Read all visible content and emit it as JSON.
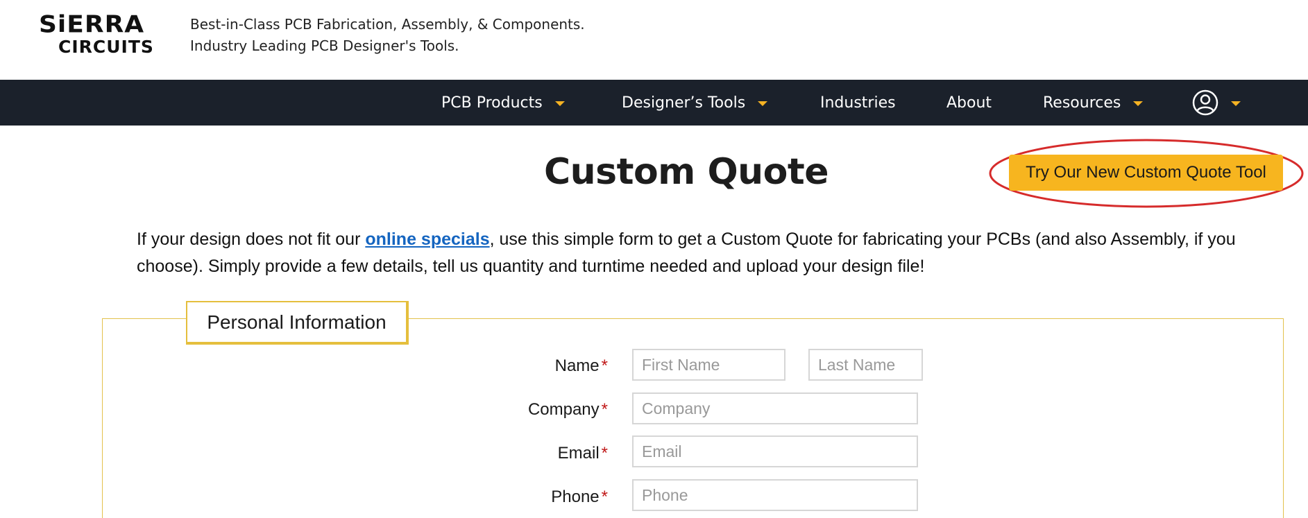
{
  "header": {
    "logo_line1": "SiERRA",
    "logo_line2": "CIRCUITS",
    "tagline_line1": "Best-in-Class PCB Fabrication, Assembly, & Components.",
    "tagline_line2": "Industry Leading PCB Designer's Tools."
  },
  "nav": {
    "items": [
      {
        "label": "PCB Products",
        "dropdown": true
      },
      {
        "label": "Designer’s Tools",
        "dropdown": true
      },
      {
        "label": "Industries",
        "dropdown": false
      },
      {
        "label": "About",
        "dropdown": false
      },
      {
        "label": "Resources",
        "dropdown": true
      }
    ],
    "account_icon": "user-circle-icon",
    "background": "#1b212b",
    "accent": "#f5b223"
  },
  "main": {
    "title": "Custom Quote",
    "cta_label": "Try Our New Custom Quote Tool",
    "cta_color": "#f7b51f",
    "highlight_color": "#d62b2b",
    "intro_before": "If your design does not fit our ",
    "intro_link": "online specials",
    "intro_after": ", use this simple form to get a Custom Quote for fabricating your PCBs (and also Assembly, if you choose). Simply provide a few details, tell us quantity and turntime needed and upload your design file!"
  },
  "form": {
    "section_title": "Personal Information",
    "required_mark": "*",
    "fields": {
      "name": {
        "label": "Name",
        "first_placeholder": "First Name",
        "last_placeholder": "Last Name"
      },
      "company": {
        "label": "Company",
        "placeholder": "Company"
      },
      "email": {
        "label": "Email",
        "placeholder": "Email"
      },
      "phone": {
        "label": "Phone",
        "placeholder": "Phone"
      }
    }
  }
}
